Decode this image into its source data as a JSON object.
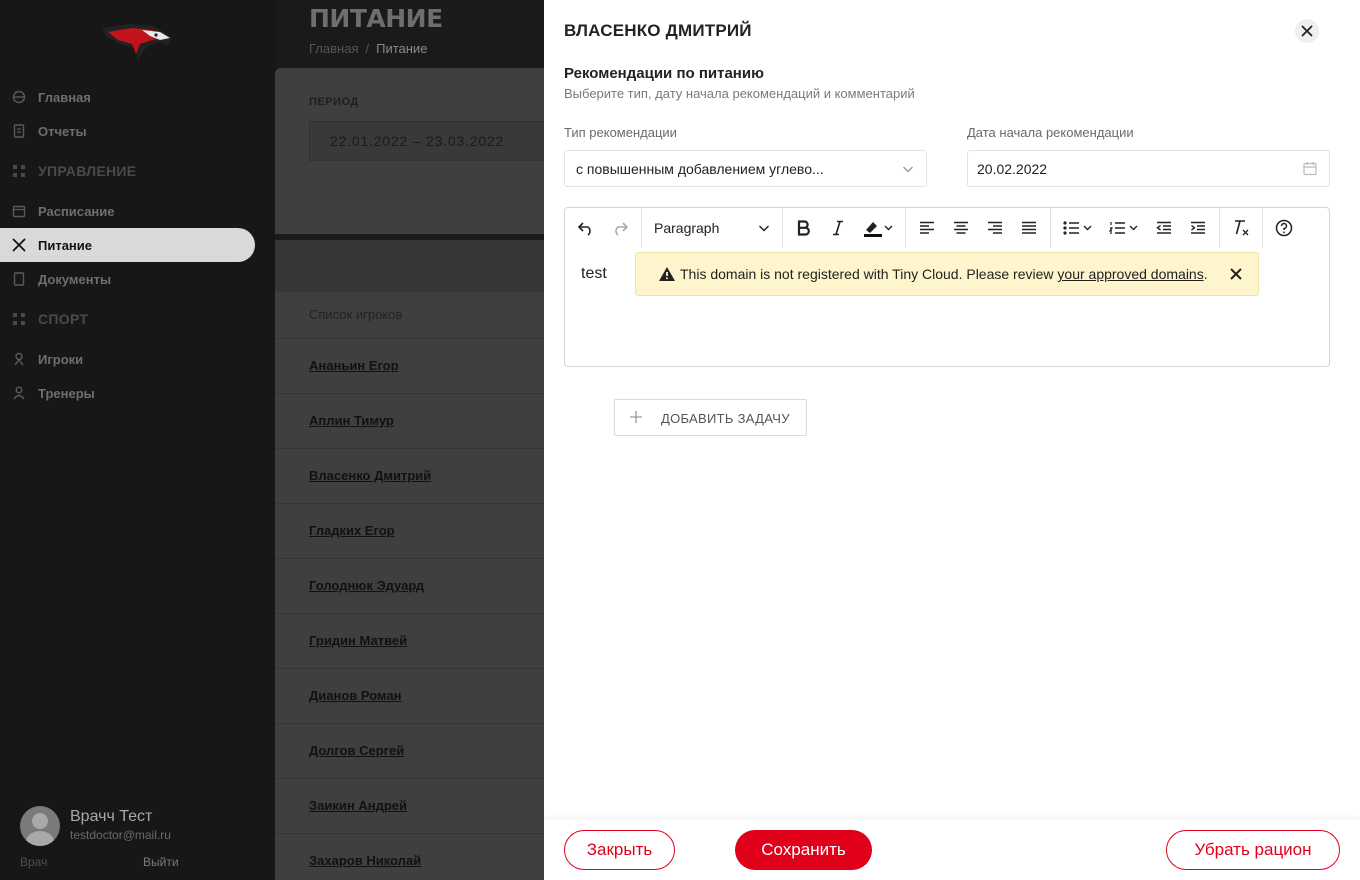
{
  "sidebar": {
    "nav": {
      "home": "Главная",
      "reports": "Отчеты",
      "section_manage": "УПРАВЛЕНИЕ",
      "schedule": "Расписание",
      "nutrition": "Питание",
      "documents": "Документы",
      "section_sport": "СПОРТ",
      "players": "Игроки",
      "coaches": "Тренеры"
    },
    "user": {
      "name": "Врачч Тест",
      "email": "testdoctor@mail.ru",
      "role": "Врач",
      "logout": "Выйти"
    }
  },
  "page": {
    "title": "ПИТАНИЕ",
    "breadcrumb": {
      "home": "Главная",
      "separator": "/",
      "current": "Питание"
    }
  },
  "filter": {
    "period_label": "ПЕРИОД",
    "period_value": "22.01.2022  –  23.03.2022"
  },
  "players_list": {
    "title": "Список игроков",
    "items": [
      "Ананьин Егор",
      "Аплин Тимур",
      "Власенко Дмитрий",
      "Гладких Егор",
      "Голоднюк Эдуард",
      "Гридин Матвей",
      "Дианов Роман",
      "Долгов Сергей",
      "Заикин Андрей",
      "Захаров Николай"
    ]
  },
  "drawer": {
    "title": "ВЛАСЕНКО ДМИТРИЙ",
    "section_title": "Рекомендации по питанию",
    "section_subtitle": "Выберите тип, дату начала рекомендаций и комментарий",
    "type_label": "Тип рекомендации",
    "type_value": "с повышенным добавлением углево...",
    "date_label": "Дата начала рекомендации",
    "date_value": "20.02.2022",
    "editor": {
      "paragraph": "Paragraph",
      "content": "test",
      "notice_text": "This domain is not registered with Tiny Cloud. Please review ",
      "notice_link": "your approved domains",
      "notice_end": "."
    },
    "add_task": "ДОБАВИТЬ ЗАДАЧУ",
    "buttons": {
      "close": "Закрыть",
      "save": "Сохранить",
      "remove": "Убрать рацион"
    }
  },
  "colors": {
    "accent": "#e0001a",
    "notice_bg": "#fff5cc",
    "sidebar_bg": "#171717",
    "overlay": "#1a1a1a"
  }
}
